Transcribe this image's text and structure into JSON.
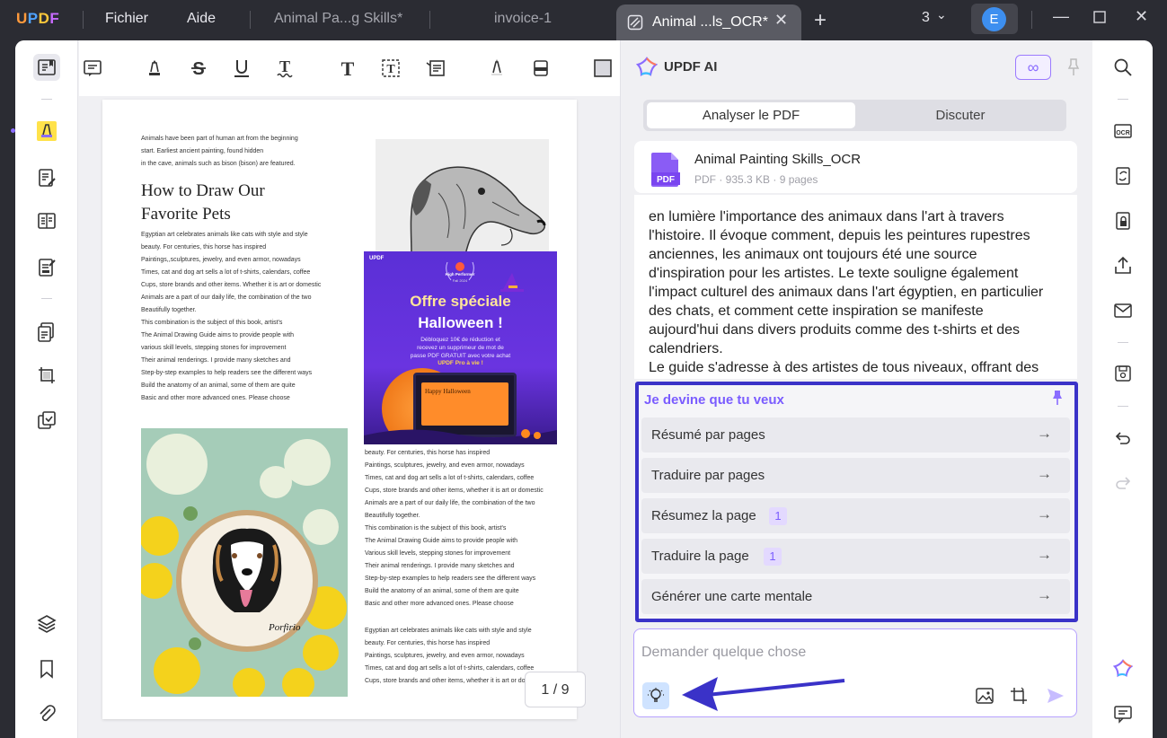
{
  "app": {
    "logo": "UPDF",
    "menu": [
      "Fichier",
      "Aide"
    ],
    "tabs": [
      "Animal Pa...g Skills*",
      "invoice-1"
    ],
    "active_tab": "Animal ...ls_OCR*",
    "tab_count": "3",
    "user_initial": "E"
  },
  "document": {
    "intro_lines": [
      "Animals have been part of human art from the beginning",
      "start. Earliest ancient painting, found hidden",
      "in the cave, animals such as bison (bison) are featured."
    ],
    "title_line1": "How to Draw Our",
    "title_line2": "Favorite Pets",
    "col1_lines": [
      "Egyptian art celebrates animals like cats with style and style",
      "beauty. For centuries, this horse has inspired",
      "Paintings,,sculptures, jewelry, and even armor, nowadays",
      "Times, cat and dog art sells a lot of t-shirts, calendars, coffee",
      "Cups, store brands and other items. Whether it is art or domestic",
      "Animals are a part of our daily life, the combination of the two",
      "Beautifully together.",
      "This combination is the subject of this book, artist's",
      "The Animal Drawing Guide aims to provide people with",
      "various skill levels, stepping stones for improvement",
      "Their animal renderings. I provide many sketches and",
      "Step-by-step examples to help readers see the different ways",
      "Build the anatomy of an animal, some of them are quite",
      "Basic and other more advanced ones. Please choose"
    ],
    "col2_lines": [
      "beauty. For centuries, this horse has inspired",
      "Paintings, sculptures, jewelry, and even armor, nowadays",
      "Times, cat and dog art sells a lot of t-shirts, calendars, coffee",
      "Cups, store brands and other items, whether it is art or domestic",
      "Animals are a part of our daily life, the combination of the two",
      "Beautifully together.",
      "This combination is the subject of this book, artist's",
      "The Animal Drawing Guide aims to provide people with",
      "Various skill levels, stepping stones for improvement",
      "Their animal renderings. I provide many sketches and",
      "Step-by-step examples to help readers see the different ways",
      "Build the anatomy of an animal, some of them are quite",
      "Basic and other more advanced ones. Please choose"
    ],
    "col2b_lines": [
      "Egyptian art celebrates animals like cats with style and style",
      "beauty. For centuries, this horse has inspired",
      "Paintings, sculptures, jewelry, and even armor, nowadays",
      "Times, cat and dog art sells a lot of t-shirts, calendars, coffee",
      "Cups, store brands and other items, whether it is art or domestic"
    ],
    "ad": {
      "logo": "UPDF",
      "badge": "High Performer",
      "badge_sub": "Fall 2024",
      "title1": "Offre spéciale",
      "title2": "Halloween !",
      "body": "Débloquez 10€ de réduction et\nrecevez un supprimeur de mot de\npasse PDF GRATUIT avec votre achat",
      "cta": "UPDF Pro à vie !",
      "screen": "Happy Halloween"
    },
    "photo_caption": "Porfirio",
    "page_indicator": "1 / 9"
  },
  "ai": {
    "title": "UPDF AI",
    "tab_active": "Analyser le PDF",
    "tab_inactive": "Discuter",
    "file_name": "Animal Painting Skills_OCR",
    "file_meta": "PDF · 935.3 KB · 9 pages",
    "answer_lines": [
      "en lumière l'importance des animaux dans l'art à travers",
      "l'histoire. Il évoque comment, depuis les peintures rupestres",
      "anciennes, les animaux ont toujours été une source",
      "d'inspiration pour les artistes. Le texte souligne également",
      "l'impact culturel des animaux dans l'art égyptien, en particulier",
      "des chats, et comment cette inspiration se manifeste",
      "aujourd'hui dans divers produits comme des t-shirts et des",
      "calendriers.",
      "Le guide s'adresse à des artistes de tous niveaux, offrant des"
    ],
    "guess_title": "Je devine que tu veux",
    "suggestions": [
      {
        "label": "Résumé par pages",
        "badge": ""
      },
      {
        "label": "Traduire par pages",
        "badge": ""
      },
      {
        "label": "Résumez la page",
        "badge": "1"
      },
      {
        "label": "Traduire la page",
        "badge": "1"
      },
      {
        "label": "Générer une carte mentale",
        "badge": ""
      }
    ],
    "ask_placeholder": "Demander quelque chose"
  },
  "colors": {
    "accent": "#7a5cff",
    "highlight_box": "#3a32c8",
    "titlebar": "#2b2c33"
  }
}
